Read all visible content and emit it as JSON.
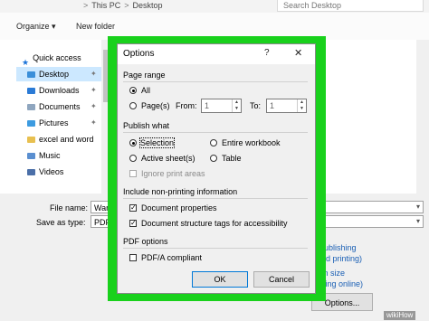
{
  "explorer": {
    "breadcrumb": [
      "This PC",
      "Desktop"
    ],
    "search_placeholder": "Search Desktop",
    "organize_label": "Organize ▾",
    "new_folder_label": "New folder",
    "nav_items": [
      {
        "label": "Quick access",
        "icon": "star-icon",
        "pinned": false
      },
      {
        "label": "Desktop",
        "icon": "folder-icon",
        "pinned": true
      },
      {
        "label": "Downloads",
        "icon": "download-icon",
        "pinned": true
      },
      {
        "label": "Documents",
        "icon": "documents-icon",
        "pinned": true
      },
      {
        "label": "Pictures",
        "icon": "pictures-icon",
        "pinned": true
      },
      {
        "label": "excel and word",
        "icon": "folder-icon",
        "pinned": false
      },
      {
        "label": "Music",
        "icon": "music-icon",
        "pinned": false
      },
      {
        "label": "Videos",
        "icon": "videos-icon",
        "pinned": false
      }
    ],
    "file_name_label": "File name:",
    "file_name_value": "Ware",
    "save_as_type_label": "Save as type:",
    "save_as_type_value": "PDF (",
    "options_text_1": "(publishing\nand printing)",
    "options_text_2": "um size\nshing online)",
    "options_button_label": "Options...",
    "watermark": "wikiHow"
  },
  "dialog": {
    "title": "Options",
    "help_label": "?",
    "close_label": "✕",
    "page_range_label": "Page range",
    "all_label": "All",
    "pages_label": "Page(s)",
    "from_label": "From:",
    "from_value": "1",
    "to_label": "To:",
    "to_value": "1",
    "publish_what_label": "Publish what",
    "selection_label": "Selection",
    "entire_workbook_label": "Entire workbook",
    "active_sheets_label": "Active sheet(s)",
    "table_label": "Table",
    "ignore_print_areas_label": "Ignore print areas",
    "non_printing_label": "Include non-printing information",
    "doc_properties_label": "Document properties",
    "doc_structure_label": "Document structure tags for accessibility",
    "pdf_options_label": "PDF options",
    "pdfa_label": "PDF/A compliant",
    "ok_label": "OK",
    "cancel_label": "Cancel",
    "state": {
      "page_range": "All",
      "publish_what": "Selection",
      "ignore_print_areas": false,
      "doc_properties": true,
      "doc_structure": true,
      "pdfa": false
    }
  },
  "colors": {
    "highlight_green": "#19d11c",
    "link_blue": "#1a5fb4",
    "selected_nav": "#cce8ff"
  }
}
